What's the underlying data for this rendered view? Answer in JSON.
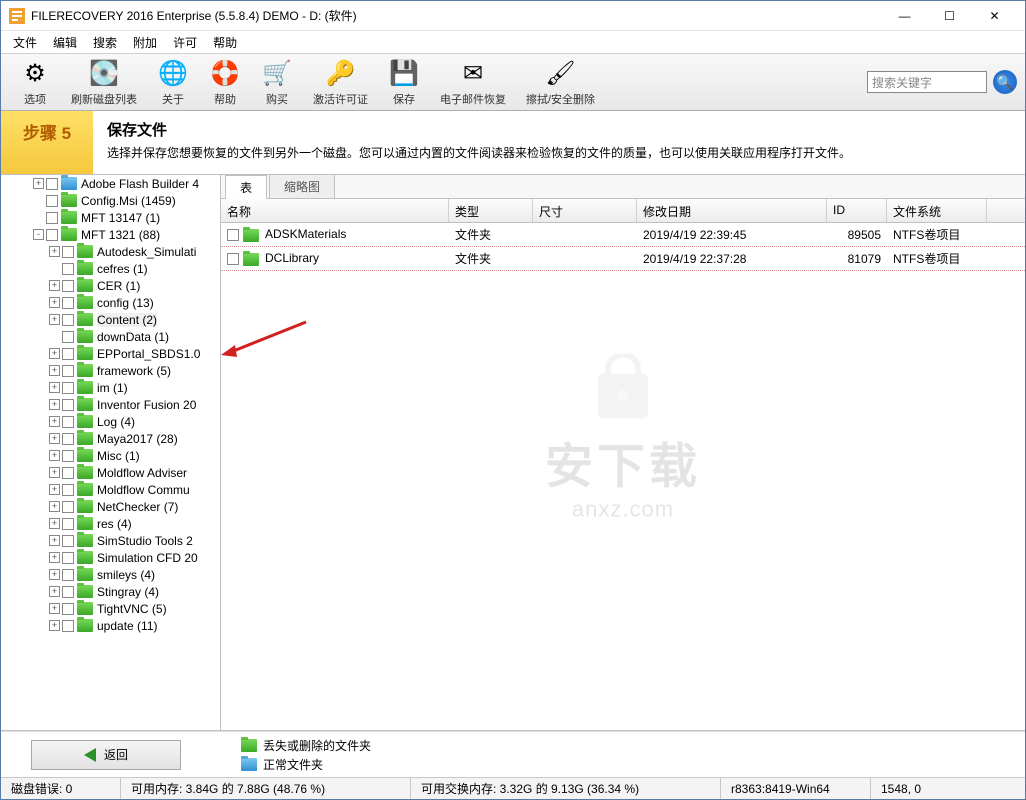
{
  "window": {
    "title": "FILERECOVERY 2016 Enterprise (5.5.8.4) DEMO - D: (软件)"
  },
  "menu": [
    "文件",
    "编辑",
    "搜索",
    "附加",
    "许可",
    "帮助"
  ],
  "toolbar": {
    "items": [
      {
        "label": "选项",
        "icon": "⚙"
      },
      {
        "label": "刷新磁盘列表",
        "icon": "💽"
      },
      {
        "label": "关于",
        "icon": "🌐"
      },
      {
        "label": "帮助",
        "icon": "🛟"
      },
      {
        "label": "购买",
        "icon": "🛒"
      },
      {
        "label": "激活许可证",
        "icon": "🔑"
      },
      {
        "label": "保存",
        "icon": "💾"
      },
      {
        "label": "电子邮件恢复",
        "icon": "✉"
      },
      {
        "label": "擦拭/安全删除",
        "icon": "🖌"
      }
    ],
    "search_placeholder": "搜索关键字"
  },
  "step": {
    "badge": "步骤 5",
    "title": "保存文件",
    "desc": "选择并保存您想要恢复的文件到另外一个磁盘。您可以通过内置的文件阅读器来检验恢复的文件的质量，也可以使用关联应用程序打开文件。"
  },
  "tree": [
    {
      "indent": 2,
      "exp": "+",
      "color": "blue",
      "label": "Adobe Flash Builder 4"
    },
    {
      "indent": 2,
      "exp": "",
      "color": "green",
      "label": "Config.Msi (1459)"
    },
    {
      "indent": 2,
      "exp": "",
      "color": "green",
      "label": "MFT 13147 (1)"
    },
    {
      "indent": 2,
      "exp": "-",
      "color": "green",
      "label": "MFT 1321 (88)"
    },
    {
      "indent": 3,
      "exp": "+",
      "color": "green",
      "label": "Autodesk_Simulati"
    },
    {
      "indent": 3,
      "exp": "",
      "color": "green",
      "label": "cefres (1)"
    },
    {
      "indent": 3,
      "exp": "+",
      "color": "green",
      "label": "CER (1)"
    },
    {
      "indent": 3,
      "exp": "+",
      "color": "green",
      "label": "config (13)"
    },
    {
      "indent": 3,
      "exp": "+",
      "color": "green",
      "label": "Content (2)",
      "selected": true
    },
    {
      "indent": 3,
      "exp": "",
      "color": "green",
      "label": "downData (1)"
    },
    {
      "indent": 3,
      "exp": "+",
      "color": "green",
      "label": "EPPortal_SBDS1.0"
    },
    {
      "indent": 3,
      "exp": "+",
      "color": "green",
      "label": "framework (5)"
    },
    {
      "indent": 3,
      "exp": "+",
      "color": "green",
      "label": "im (1)"
    },
    {
      "indent": 3,
      "exp": "+",
      "color": "green",
      "label": "Inventor Fusion 20"
    },
    {
      "indent": 3,
      "exp": "+",
      "color": "green",
      "label": "Log (4)"
    },
    {
      "indent": 3,
      "exp": "+",
      "color": "green",
      "label": "Maya2017 (28)"
    },
    {
      "indent": 3,
      "exp": "+",
      "color": "green",
      "label": "Misc (1)"
    },
    {
      "indent": 3,
      "exp": "+",
      "color": "green",
      "label": "Moldflow Adviser"
    },
    {
      "indent": 3,
      "exp": "+",
      "color": "green",
      "label": "Moldflow Commu"
    },
    {
      "indent": 3,
      "exp": "+",
      "color": "green",
      "label": "NetChecker (7)"
    },
    {
      "indent": 3,
      "exp": "+",
      "color": "green",
      "label": "res (4)"
    },
    {
      "indent": 3,
      "exp": "+",
      "color": "green",
      "label": "SimStudio Tools 2"
    },
    {
      "indent": 3,
      "exp": "+",
      "color": "green",
      "label": "Simulation CFD 20"
    },
    {
      "indent": 3,
      "exp": "+",
      "color": "green",
      "label": "smileys (4)"
    },
    {
      "indent": 3,
      "exp": "+",
      "color": "green",
      "label": "Stingray (4)"
    },
    {
      "indent": 3,
      "exp": "+",
      "color": "green",
      "label": "TightVNC (5)"
    },
    {
      "indent": 3,
      "exp": "+",
      "color": "green",
      "label": "update (11)"
    }
  ],
  "tabs": {
    "active": "表",
    "inactive": "缩略图"
  },
  "columns": {
    "name": "名称",
    "type": "类型",
    "size": "尺寸",
    "date": "修改日期",
    "id": "ID",
    "fs": "文件系统"
  },
  "rows": [
    {
      "name": "ADSKMaterials",
      "type": "文件夹",
      "size": "",
      "date": "2019/4/19 22:39:45",
      "id": "89505",
      "fs": "NTFS卷项目"
    },
    {
      "name": "DCLibrary",
      "type": "文件夹",
      "size": "",
      "date": "2019/4/19 22:37:28",
      "id": "81079",
      "fs": "NTFS卷项目"
    }
  ],
  "watermark": {
    "big": "安下载",
    "small": "anxz.com"
  },
  "back_button": "返回",
  "legend": {
    "lost": "丢失或删除的文件夹",
    "normal": "正常文件夹"
  },
  "status": {
    "errors": "磁盘错误: 0",
    "mem": "可用内存: 3.84G 的 7.88G (48.76 %)",
    "swap": "可用交换内存: 3.32G 的 9.13G (36.34 %)",
    "build": "r8363:8419-Win64",
    "extra": "1548, 0"
  }
}
